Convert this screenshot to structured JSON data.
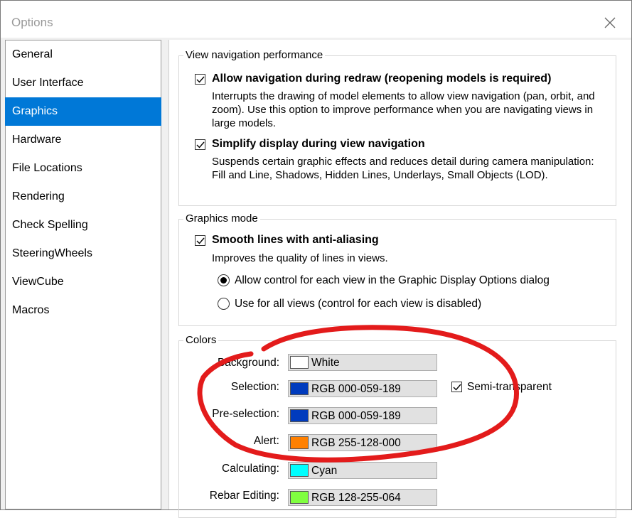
{
  "window": {
    "title": "Options"
  },
  "sidebar": {
    "items": [
      {
        "label": "General",
        "selected": false
      },
      {
        "label": "User Interface",
        "selected": false
      },
      {
        "label": "Graphics",
        "selected": true
      },
      {
        "label": "Hardware",
        "selected": false
      },
      {
        "label": "File Locations",
        "selected": false
      },
      {
        "label": "Rendering",
        "selected": false
      },
      {
        "label": "Check Spelling",
        "selected": false
      },
      {
        "label": "SteeringWheels",
        "selected": false
      },
      {
        "label": "ViewCube",
        "selected": false
      },
      {
        "label": "Macros",
        "selected": false
      }
    ]
  },
  "view_navigation": {
    "legend": "View navigation performance",
    "allow_nav": {
      "label": "Allow navigation during redraw (reopening models is required)",
      "checked": true,
      "desc": "Interrupts the drawing of model elements to allow view navigation (pan, orbit, and zoom). Use this option to improve performance when you are navigating views in large models."
    },
    "simplify": {
      "label": "Simplify display during view navigation",
      "checked": true,
      "desc": "Suspends certain graphic effects and reduces detail during camera manipulation: Fill and Line, Shadows, Hidden Lines, Underlays, Small Objects (LOD)."
    }
  },
  "graphics_mode": {
    "legend": "Graphics mode",
    "smooth": {
      "label": "Smooth lines with anti-aliasing",
      "checked": true,
      "desc": "Improves the quality of lines in views."
    },
    "radio_each_view": {
      "label": "Allow control for each view in the Graphic Display Options dialog",
      "selected": true
    },
    "radio_all_views": {
      "label": "Use for all views (control for each view is disabled)",
      "selected": false
    }
  },
  "colors": {
    "legend": "Colors",
    "semi_transparent": {
      "label": "Semi-transparent",
      "checked": true
    },
    "items": [
      {
        "label": "Background:",
        "value": "White",
        "color": "#ffffff"
      },
      {
        "label": "Selection:",
        "value": "RGB 000-059-189",
        "color": "#003bbd"
      },
      {
        "label": "Pre-selection:",
        "value": "RGB 000-059-189",
        "color": "#003bbd"
      },
      {
        "label": "Alert:",
        "value": "RGB 255-128-000",
        "color": "#ff8000"
      },
      {
        "label": "Calculating:",
        "value": "Cyan",
        "color": "#00ffff"
      },
      {
        "label": "Rebar Editing:",
        "value": "RGB 128-255-064",
        "color": "#80ff40"
      }
    ]
  },
  "theme": {
    "accent": "#0078d7",
    "annotation": "#e31b1b"
  },
  "icons": {
    "close": "close-icon",
    "check": "checkmark-icon"
  }
}
